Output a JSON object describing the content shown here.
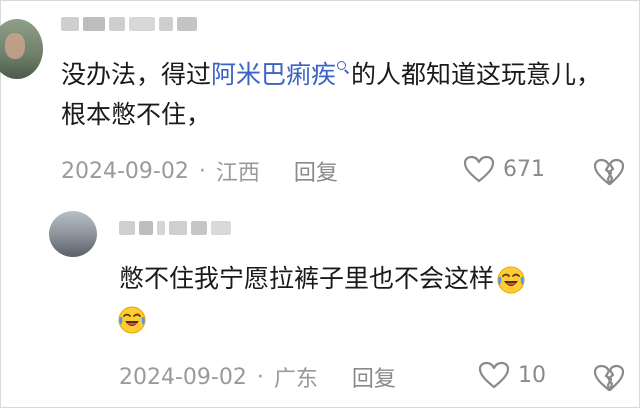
{
  "comments": [
    {
      "text_before_link": "没办法，得过",
      "link_text": "阿米巴痢疾",
      "text_after_link": "的人都知道这玩意儿，根本憋不住，",
      "date": "2024-09-02",
      "separator": "·",
      "location": "江西",
      "reply_label": "回复",
      "likes": "671"
    },
    {
      "text": "憋不住我宁愿拉裤子里也不会这样",
      "date": "2024-09-02",
      "separator": "·",
      "location": "广东",
      "reply_label": "回复",
      "likes": "10"
    }
  ],
  "icons": {
    "like": "heart-outline-icon",
    "dislike": "broken-heart-icon",
    "search": "search-icon",
    "emoji": "crying-laughing-emoji"
  },
  "colors": {
    "link": "#3b62c7",
    "meta": "#9a9a9a",
    "text": "#1a1a1a"
  }
}
